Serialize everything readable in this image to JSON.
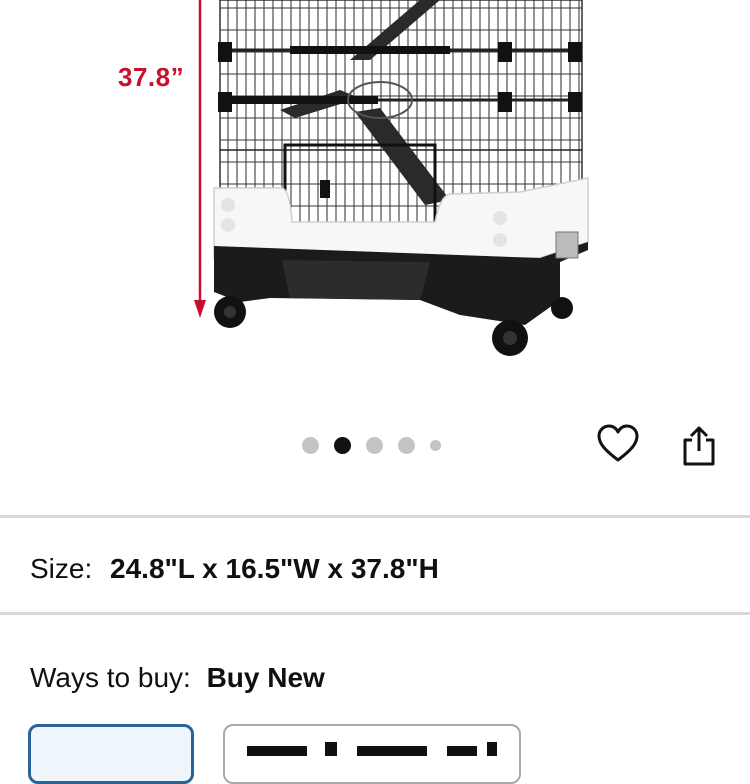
{
  "product_image": {
    "dimension_label": "37.8”"
  },
  "gallery": {
    "dots": [
      {
        "active": false
      },
      {
        "active": true
      },
      {
        "active": false
      },
      {
        "active": false
      },
      {
        "active": false
      }
    ]
  },
  "actions": {
    "favorite_icon": "heart-outline",
    "share_icon": "share-upload"
  },
  "size": {
    "label": "Size:",
    "value": "24.8\"L x 16.5\"W x 37.8\"H"
  },
  "ways_to_buy": {
    "label": "Ways to buy:",
    "value": "Buy New"
  },
  "colors": {
    "dimension_red": "#c8102e",
    "selected_border": "#2a6496",
    "divider": "#d5d9d9"
  }
}
